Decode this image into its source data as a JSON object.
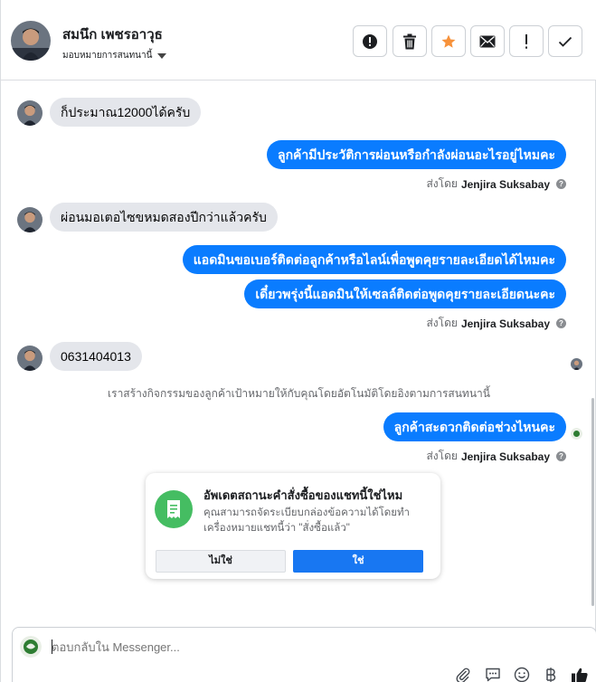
{
  "header": {
    "contact_name": "สมนึก เพชรอาวุธ",
    "assign_label": "มอบหมายการสนทนานี้",
    "actions": [
      {
        "icon": "alert-circle-icon",
        "name": "mark-spam-button"
      },
      {
        "icon": "trash-icon",
        "name": "delete-button"
      },
      {
        "icon": "star-icon",
        "name": "star-button"
      },
      {
        "icon": "envelope-icon",
        "name": "mark-unread-button"
      },
      {
        "icon": "exclamation-icon",
        "name": "follow-up-button"
      },
      {
        "icon": "checkmark-icon",
        "name": "done-button"
      }
    ],
    "star_color": "#f7923b"
  },
  "messages": [
    {
      "direction": "in",
      "text": "ก็ประมาณ12000ได้ครับ"
    },
    {
      "direction": "out",
      "text": "ลูกค้ามีประวัติการผ่อนหรือกำลังผ่อนอะไรอยู่ไหมคะ"
    },
    {
      "direction": "in",
      "text": "ผ่อนมอเตอไซขหมดสองปีกว่าแล้วครับ"
    },
    {
      "direction": "out",
      "text": "แอดมินขอเบอร์ติดต่อลูกค้าหรือไลน์เพื่อพูดคุยรายละเอียดได้ไหมคะ"
    },
    {
      "direction": "out",
      "text": "เดี๋ยวพรุ่งนี้แอดมินให้เซลล์ติดต่อพูดคุยรายละเอียดนะคะ"
    },
    {
      "direction": "in",
      "text": "0631404013"
    },
    {
      "direction": "out",
      "text": "ลูกค้าสะดวกติดต่อช่วงไหนคะ"
    }
  ],
  "sent_by": {
    "prefix": "ส่งโดย",
    "name": "Jenjira Suksabay",
    "help": "?"
  },
  "system_note": "เราสร้างกิจกรรมของลูกค้าเป้าหมายให้กับคุณโดยอัตโนมัติโดยอิงตามการสนทนานี้",
  "card": {
    "title": "อัพเดตสถานะคำสั่งซื้อของแชทนี้ใช่ไหม",
    "description": "คุณสามารถจัดระเบียบกล่องข้อความได้โดยทำเครื่องหมายแชทนี้ว่า \"สั่งซื้อแล้ว\"",
    "no_label": "ไม่ใช่",
    "yes_label": "ใช่",
    "icon": "receipt-icon",
    "icon_bg": "#45bd62"
  },
  "composer": {
    "placeholder": "ตอบกลับใน Messenger...",
    "tools": [
      "paperclip-icon",
      "saved-reply-icon",
      "emoji-icon",
      "baht-icon",
      "thumbs-up-icon"
    ]
  },
  "colors": {
    "outgoing_bubble": "#0a7cff",
    "incoming_bubble": "#e4e6eb",
    "primary_button": "#1877f2"
  }
}
